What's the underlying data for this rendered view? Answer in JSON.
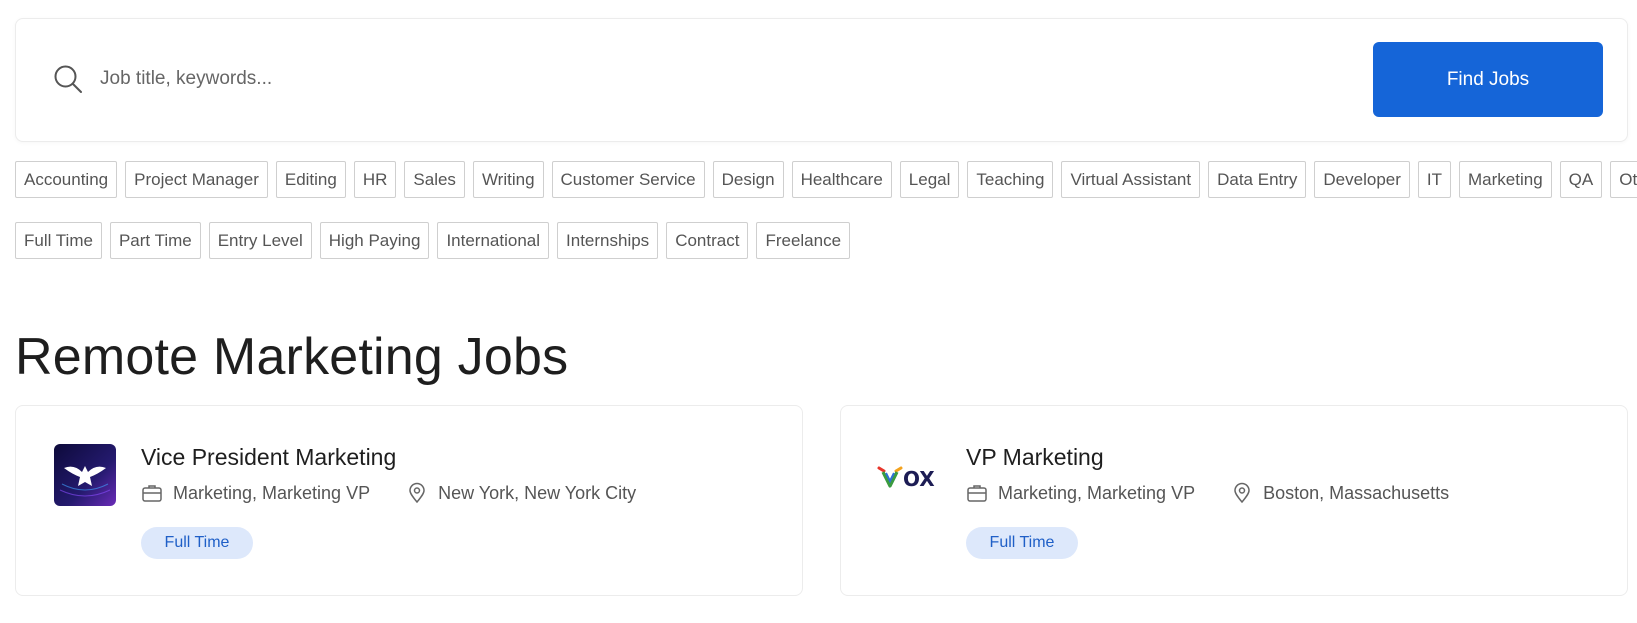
{
  "search": {
    "placeholder": "Job title, keywords...",
    "button_label": "Find Jobs"
  },
  "categories": [
    "Accounting",
    "Project Manager",
    "Editing",
    "HR",
    "Sales",
    "Writing",
    "Customer Service",
    "Design",
    "Healthcare",
    "Legal",
    "Teaching",
    "Virtual Assistant",
    "Data Entry",
    "Developer",
    "IT",
    "Marketing",
    "QA",
    "Other"
  ],
  "job_types": [
    "Full Time",
    "Part Time",
    "Entry Level",
    "High Paying",
    "International",
    "Internships",
    "Contract",
    "Freelance"
  ],
  "page_title": "Remote Marketing Jobs",
  "jobs": [
    {
      "title": "Vice President Marketing",
      "category": "Marketing, Marketing VP",
      "location": "New York, New York City",
      "type": "Full Time",
      "logo_icon": "dove-logo-icon"
    },
    {
      "title": "VP Marketing",
      "category": "Marketing, Marketing VP",
      "location": "Boston, Massachusetts",
      "type": "Full Time",
      "logo_icon": "ox-logo-icon",
      "logo_text": "OX"
    }
  ],
  "colors": {
    "primary": "#1565d8",
    "badge_bg": "#dde8fb",
    "badge_text": "#1f5fc7"
  }
}
